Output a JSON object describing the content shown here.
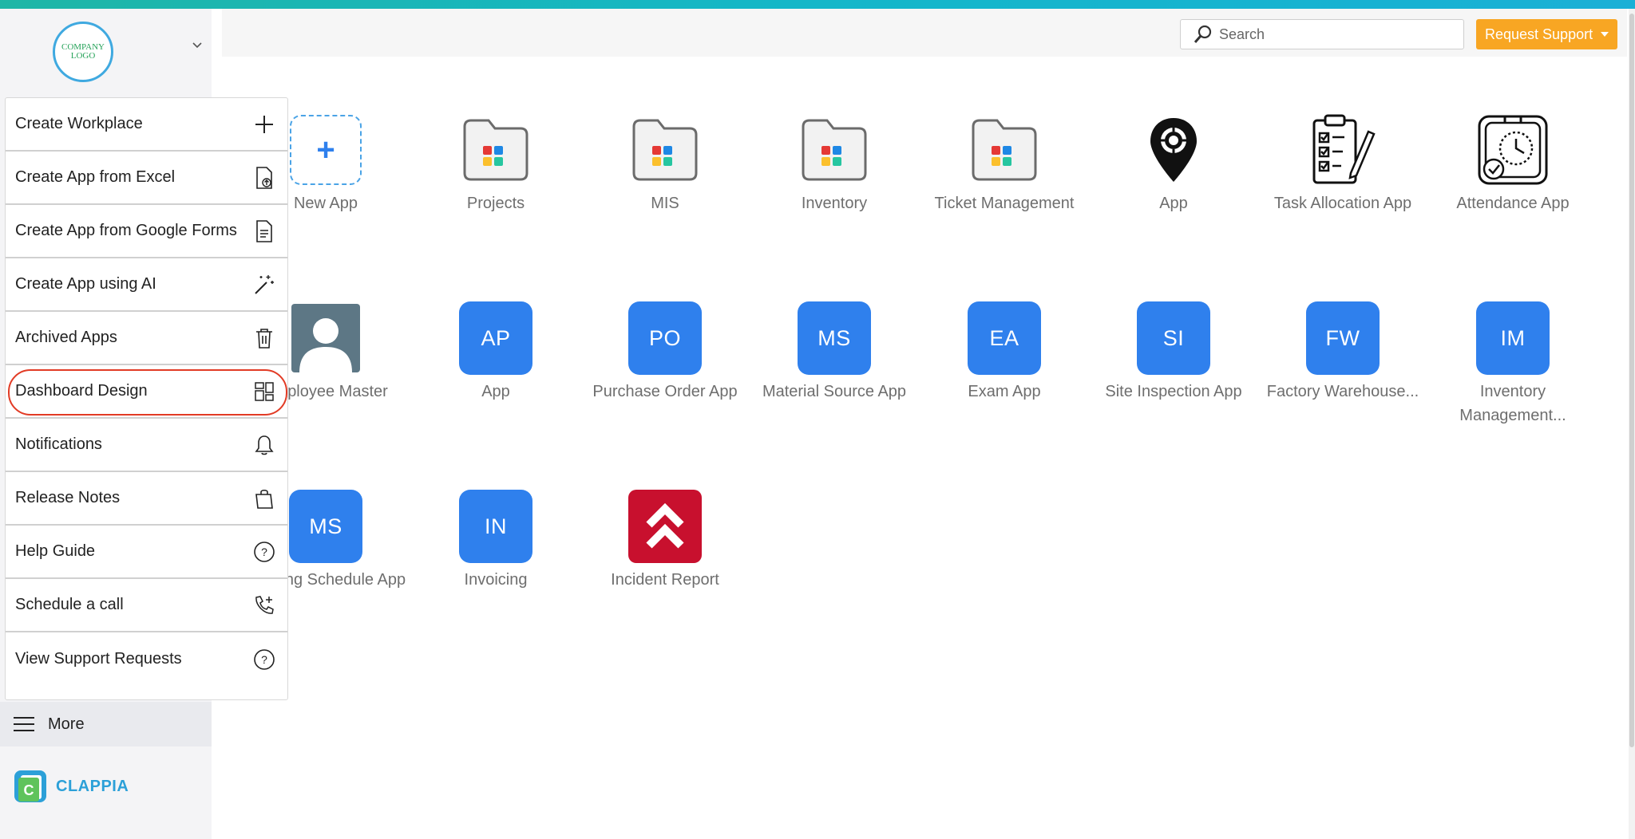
{
  "sidebar": {
    "logo_text": "COMPANY LOGO",
    "brand_name": "CLAPPIA",
    "more_label": "More"
  },
  "dropdown": {
    "items": [
      {
        "label": "Create Workplace",
        "icon": "plus-icon"
      },
      {
        "label": "Create App from Excel",
        "icon": "file-upload-icon"
      },
      {
        "label": "Create App from Google Forms",
        "icon": "document-icon"
      },
      {
        "label": "Create App using AI",
        "icon": "magic-wand-icon"
      },
      {
        "label": "Archived Apps",
        "icon": "trash-icon"
      },
      {
        "label": "Dashboard Design",
        "icon": "dashboard-icon",
        "highlighted": true
      },
      {
        "label": "Notifications",
        "icon": "bell-icon"
      },
      {
        "label": "Release Notes",
        "icon": "shopping-bag-icon"
      },
      {
        "label": "Help Guide",
        "icon": "help-circle-icon"
      },
      {
        "label": "Schedule a call",
        "icon": "phone-add-icon"
      },
      {
        "label": "View Support Requests",
        "icon": "help-circle-icon"
      }
    ]
  },
  "header": {
    "search_placeholder": "Search",
    "support_label": "Request Support"
  },
  "apps": {
    "row1": [
      {
        "label": "New App",
        "icon": "new-app-icon"
      },
      {
        "label": "Projects",
        "icon": "folder-icon"
      },
      {
        "label": "MIS",
        "icon": "folder-icon"
      },
      {
        "label": "Inventory",
        "icon": "folder-icon"
      },
      {
        "label": "Ticket Management",
        "icon": "folder-icon"
      },
      {
        "label": "App",
        "icon": "map-pin-icon"
      },
      {
        "label": "Task Allocation App",
        "icon": "clipboard-checklist-icon"
      },
      {
        "label": "Attendance App",
        "icon": "clock-icon"
      }
    ],
    "row2": [
      {
        "label": "Employee Master",
        "icon": "person-icon"
      },
      {
        "label": "App",
        "abbr": "AP"
      },
      {
        "label": "Purchase Order App",
        "abbr": "PO"
      },
      {
        "label": "Material Source App",
        "abbr": "MS"
      },
      {
        "label": "Exam App",
        "abbr": "EA"
      },
      {
        "label": "Site Inspection App",
        "abbr": "SI"
      },
      {
        "label": "Factory Warehouse...",
        "abbr": "FW"
      },
      {
        "label": "Inventory Management...",
        "abbr": "IM"
      }
    ],
    "row3": [
      {
        "label": "Meeting Schedule App",
        "abbr": "MS"
      },
      {
        "label": "Invoicing",
        "abbr": "IN"
      },
      {
        "label": "Incident Report",
        "icon": "chevrons-up-icon"
      }
    ]
  },
  "colors": {
    "accent_blue": "#2f80ed",
    "support_orange": "#f8a623",
    "highlight_red": "#e23b25",
    "incident_red": "#c8102e"
  }
}
